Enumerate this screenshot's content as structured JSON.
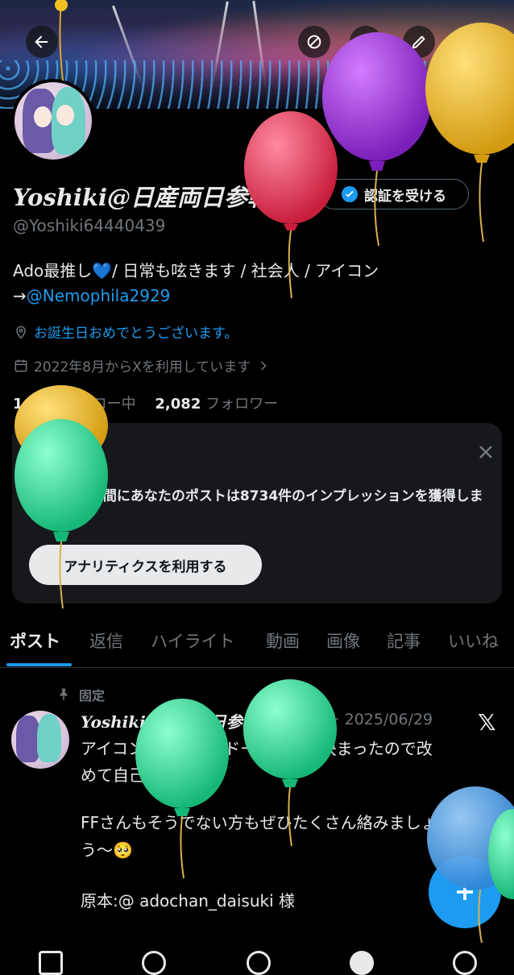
{
  "profile": {
    "display_name": "Yoshiki@日産両日参戦",
    "handle": "@Yoshiki64440439",
    "verify_label": "認証を受ける",
    "bio_line1": "Ado最推し💙/ 日常も呟きます / 社会人 / アイコン",
    "bio_arrow": "→",
    "bio_link": "@Nemophila2929",
    "birthday": "お誕生日おめでとうございます。",
    "joined": "2022年8月からXを利用しています",
    "following_count": "1,988",
    "following_label": "フォロー中",
    "followers_count": "2,082",
    "followers_label": "フォロワー"
  },
  "card": {
    "text": "過去7日間にあなたのポストは8734件のインプレッションを獲得しました",
    "button": "アナリティクスを利用する"
  },
  "tabs": [
    "ポスト",
    "返信",
    "ハイライト",
    "動画",
    "画像",
    "記事",
    "いいね"
  ],
  "post": {
    "pinned_label": "固定",
    "name": "Yoshiki@日産両日参戦",
    "meta": "@Yo... · 2025/06/29",
    "lines": [
      "アイコンも変わり、ドーム参戦も決まったので改",
      "めて自己紹介！！",
      "",
      "FFさんもそうでない方もぜひたくさん絡みましょ",
      "う〜🥺",
      "",
      "原本:@ adochan_daisuki 様"
    ]
  },
  "icons": {
    "back": "arrow-left-icon",
    "circle": "circle-slash-icon",
    "search": "search-icon",
    "edit": "pencil-icon",
    "share": "share-icon"
  },
  "colors": {
    "accent": "#1d9bf0",
    "balloon_red": "#e0304e",
    "balloon_purple": "#9b2fd8",
    "balloon_yellow": "#e6b322",
    "balloon_green": "#2ed896",
    "balloon_blue": "#4aa3e8"
  }
}
